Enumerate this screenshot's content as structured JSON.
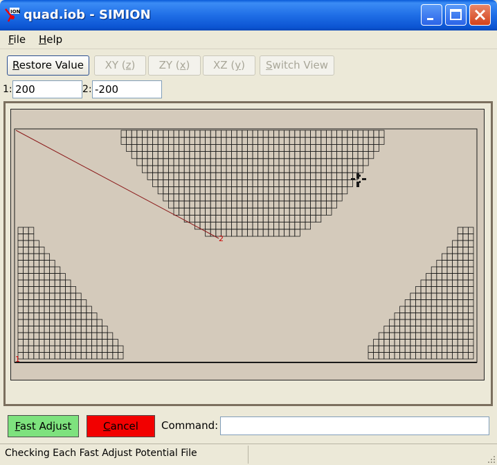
{
  "window": {
    "title": "quad.iob - SIMION",
    "icon": "simion-ion-icon"
  },
  "menu": [
    {
      "label": "File",
      "accel": "F",
      "rest": "ile"
    },
    {
      "label": "Help",
      "accel": "H",
      "rest": "elp"
    }
  ],
  "toolbar": {
    "restore": {
      "accel": "R",
      "rest": "estore Value"
    },
    "xy": {
      "pre": "XY (",
      "accel": "z",
      "post": ")"
    },
    "zy": {
      "pre": "ZY (",
      "accel": "x",
      "post": ")"
    },
    "xz": {
      "pre": "XZ (",
      "accel": "y",
      "post": ")"
    },
    "switch_view": {
      "accel": "S",
      "rest": "witch View"
    }
  },
  "fields": [
    {
      "label": "1:",
      "value": "200"
    },
    {
      "label": "2:",
      "value": "-200"
    }
  ],
  "view": {
    "point_labels": [
      "1",
      "2"
    ],
    "colors": {
      "background": "#d4cabb",
      "grid": "#1a1a1a",
      "trajectory": "#8b1a1a",
      "marker": "#cc0000"
    }
  },
  "bottom": {
    "fast_adjust": {
      "accel": "F",
      "rest": "ast Adjust"
    },
    "cancel": {
      "accel": "C",
      "rest": "ancel"
    },
    "command_label": "Command:",
    "command_value": ""
  },
  "status": {
    "text": "Checking Each Fast Adjust Potential File"
  }
}
